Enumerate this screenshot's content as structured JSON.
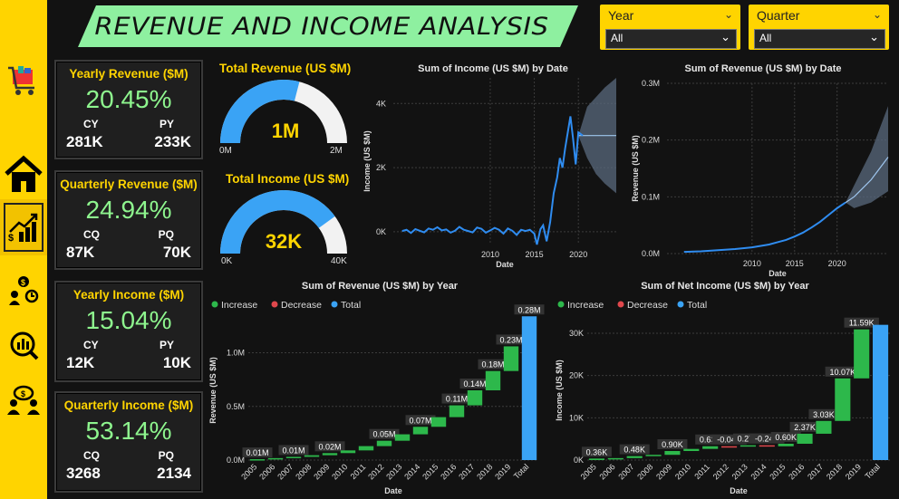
{
  "header": {
    "title": "REVENUE AND INCOME ANALYSIS"
  },
  "slicers": [
    {
      "label": "Year",
      "value": "All"
    },
    {
      "label": "Quarter",
      "value": "All"
    }
  ],
  "nav": {
    "items": [
      "cart-icon",
      "home-icon",
      "chart-growth-icon",
      "money-people-icon",
      "finance-analysis-icon",
      "team-dollar-icon"
    ]
  },
  "kpis": [
    {
      "title": "Yearly Revenue ($M)",
      "value": "20.45%",
      "left_label": "CY",
      "right_label": "PY",
      "left_value": "281K",
      "right_value": "233K"
    },
    {
      "title": "Quarterly Revenue ($M)",
      "value": "24.94%",
      "left_label": "CQ",
      "right_label": "PQ",
      "left_value": "87K",
      "right_value": "70K"
    },
    {
      "title": "Yearly Income ($M)",
      "value": "15.04%",
      "left_label": "CY",
      "right_label": "PY",
      "left_value": "12K",
      "right_value": "10K"
    },
    {
      "title": "Quarterly Income ($M)",
      "value": "53.14%",
      "left_label": "CQ",
      "right_label": "PQ",
      "left_value": "3268",
      "right_value": "2134"
    }
  ],
  "gauges": [
    {
      "title": "Total Revenue (US $M)",
      "value_label": "1M",
      "min_label": "0M",
      "max_label": "2M",
      "fraction": 0.58
    },
    {
      "title": "Total Income (US $M)",
      "value_label": "32K",
      "min_label": "0K",
      "max_label": "40K",
      "fraction": 0.8
    }
  ],
  "colors": {
    "accent": "#ffd400",
    "increase": "#2db84b",
    "decrease": "#e0474c",
    "total": "#3aa3f5",
    "line": "#2f8cf0",
    "kpi_value": "#8ef58e"
  },
  "chart_data": [
    {
      "type": "line",
      "title": "Sum of Income (US $M) by Date",
      "xlabel": "Date",
      "ylabel": "Income (US $M)",
      "ylim": [
        -400,
        4800
      ],
      "xlim": [
        1999,
        2024.3
      ],
      "xticks": [
        2010,
        2015,
        2020
      ],
      "yticks": [
        {
          "v": 0,
          "label": "0K"
        },
        {
          "v": 2000,
          "label": "2K"
        },
        {
          "v": 4000,
          "label": "4K"
        }
      ],
      "x": [
        2000.0,
        2000.5,
        2001.0,
        2001.5,
        2002.0,
        2002.5,
        2003.0,
        2003.5,
        2004.0,
        2004.5,
        2005.0,
        2005.5,
        2006.0,
        2006.5,
        2007.0,
        2007.5,
        2008.0,
        2008.5,
        2009.0,
        2009.5,
        2010.0,
        2010.5,
        2011.0,
        2011.5,
        2012.0,
        2012.5,
        2013.0,
        2013.5,
        2014.0,
        2014.5,
        2015.0,
        2015.3,
        2015.7,
        2016.0,
        2016.4,
        2016.8,
        2017.2,
        2017.6,
        2017.9,
        2018.2,
        2018.5,
        2018.8,
        2019.1,
        2019.4,
        2019.7,
        2020.0,
        2020.5
      ],
      "y": [
        20,
        60,
        -40,
        80,
        30,
        -20,
        100,
        60,
        140,
        40,
        70,
        -30,
        30,
        150,
        60,
        20,
        -20,
        130,
        90,
        -30,
        40,
        120,
        60,
        -60,
        100,
        30,
        -100,
        60,
        20,
        60,
        -60,
        -400,
        80,
        200,
        -300,
        300,
        1200,
        1700,
        2300,
        2000,
        2600,
        3100,
        3600,
        2900,
        2100,
        3100,
        3000
      ],
      "forecast": {
        "x": [
          2020.0,
          2021.0,
          2022.0,
          2023.0,
          2024.3
        ],
        "y": [
          3000,
          3000,
          3000,
          3000,
          3000
        ],
        "lower": [
          3000,
          2300,
          1800,
          1500,
          1200
        ],
        "upper": [
          3000,
          3900,
          4200,
          4500,
          4800
        ]
      }
    },
    {
      "type": "line",
      "title": "Sum of Revenue (US $M) by Date",
      "xlabel": "Date",
      "ylabel": "Revenue (US $M)",
      "ylim": [
        0,
        0.3
      ],
      "xlim": [
        2000,
        2026
      ],
      "xticks": [
        2010,
        2015,
        2020
      ],
      "yticks": [
        {
          "v": 0,
          "label": "0.0M"
        },
        {
          "v": 0.1,
          "label": "0.1M"
        },
        {
          "v": 0.2,
          "label": "0.2M"
        },
        {
          "v": 0.3,
          "label": "0.3M"
        }
      ],
      "x": [
        2002,
        2004,
        2006,
        2008,
        2010,
        2012,
        2013,
        2014,
        2015,
        2016,
        2017,
        2018,
        2019,
        2020,
        2021
      ],
      "y": [
        0.003,
        0.004,
        0.006,
        0.008,
        0.011,
        0.016,
        0.02,
        0.024,
        0.03,
        0.037,
        0.046,
        0.056,
        0.068,
        0.08,
        0.09
      ],
      "forecast": {
        "x": [
          2021,
          2022,
          2023,
          2024,
          2025,
          2026
        ],
        "y": [
          0.09,
          0.1,
          0.115,
          0.13,
          0.15,
          0.17
        ],
        "lower": [
          0.09,
          0.08,
          0.085,
          0.09,
          0.1,
          0.11
        ],
        "upper": [
          0.09,
          0.12,
          0.15,
          0.18,
          0.22,
          0.26
        ]
      }
    },
    {
      "type": "waterfall",
      "title": "Sum of Revenue (US $M) by Year",
      "xlabel": "Date",
      "ylabel": "Revenue (US $M)",
      "ylim": [
        0,
        1.3
      ],
      "yticks": [
        {
          "v": 0,
          "label": "0.0M"
        },
        {
          "v": 0.5,
          "label": "0.5M"
        },
        {
          "v": 1.0,
          "label": "1.0M"
        }
      ],
      "legend": [
        "Increase",
        "Decrease",
        "Total"
      ],
      "categories": [
        "2005",
        "2006",
        "2007",
        "2008",
        "2009",
        "2010",
        "2011",
        "2012",
        "2013",
        "2014",
        "2015",
        "2016",
        "2017",
        "2018",
        "2019",
        "Total"
      ],
      "values": [
        0.008,
        0.01,
        0.012,
        0.015,
        0.02,
        0.025,
        0.04,
        0.05,
        0.06,
        0.07,
        0.09,
        0.11,
        0.14,
        0.18,
        0.23,
        0.28
      ],
      "total": 1.34,
      "data_labels": {
        "0": "0.01M",
        "2": "0.01M",
        "4": "0.02M",
        "7": "0.05M",
        "9": "0.07M",
        "11": "0.11M",
        "12": "0.14M",
        "13": "0.18M",
        "14": "0.23M",
        "15": "0.28M"
      }
    },
    {
      "type": "waterfall",
      "title": "Sum of Net Income (US $M) by Year",
      "xlabel": "Date",
      "ylabel": "Income (US $M)",
      "ylim": [
        0,
        33000
      ],
      "yticks": [
        {
          "v": 0,
          "label": "0K"
        },
        {
          "v": 10000,
          "label": "10K"
        },
        {
          "v": 20000,
          "label": "20K"
        },
        {
          "v": 30000,
          "label": "30K"
        }
      ],
      "legend": [
        "Increase",
        "Decrease",
        "Total"
      ],
      "categories": [
        "2005",
        "2006",
        "2007",
        "2008",
        "2009",
        "2010",
        "2011",
        "2012",
        "2013",
        "2014",
        "2015",
        "2016",
        "2017",
        "2018",
        "2019",
        "Total"
      ],
      "values": [
        360,
        100,
        480,
        300,
        900,
        500,
        630,
        -40,
        270,
        -240,
        600,
        2370,
        3030,
        10070,
        11590
      ],
      "total": 32000,
      "data_labels": {
        "0": "0.36K",
        "2": "0.48K",
        "4": "0.90K",
        "6": "0.63K",
        "7": "-0.04K",
        "8": "0.27K",
        "9": "-0.24K",
        "10": "0.60K",
        "11": "2.37K",
        "12": "3.03K",
        "13": "10.07K",
        "14": "11.59K"
      }
    }
  ]
}
